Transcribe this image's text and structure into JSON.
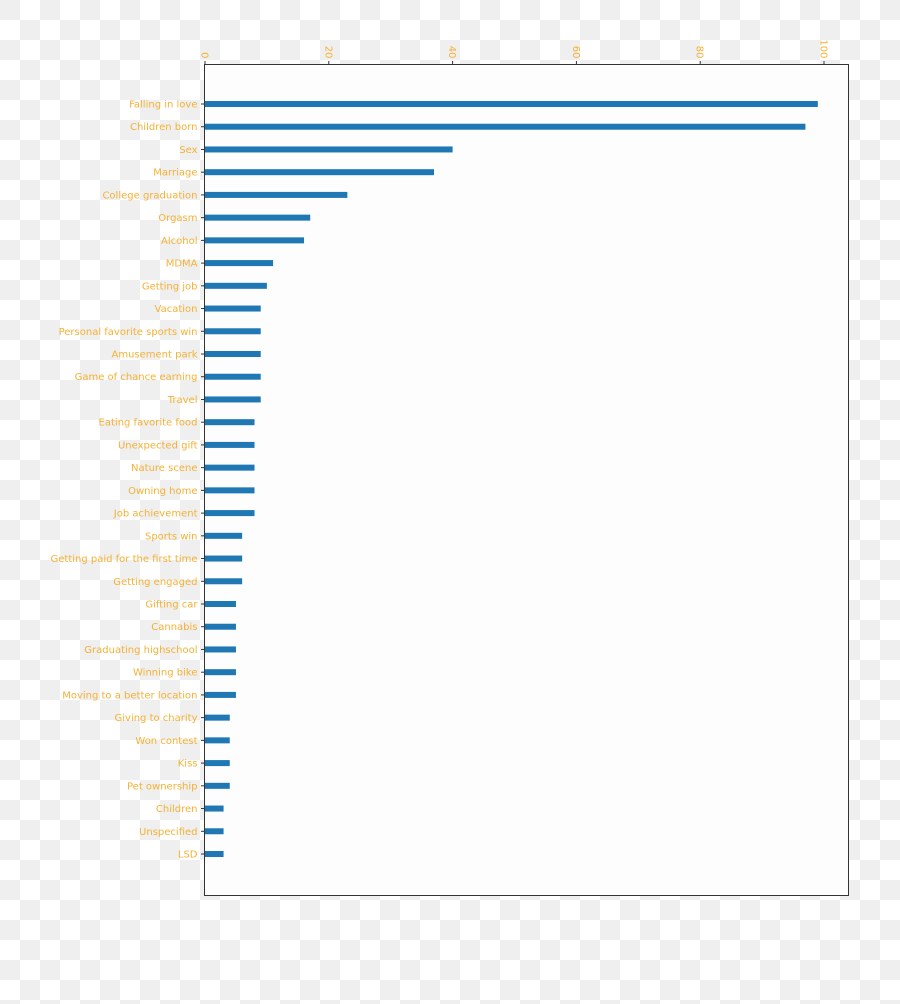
{
  "chart_data": {
    "type": "bar",
    "orientation": "horizontal",
    "title": "",
    "xlabel": "",
    "ylabel": "",
    "xlim": [
      0,
      104
    ],
    "xticks": [
      0,
      20,
      40,
      60,
      80,
      100
    ],
    "xtick_labels": [
      "0",
      "20",
      "40",
      "60",
      "80",
      "100"
    ],
    "x_axis_position": "top",
    "grid": false,
    "legend": null,
    "colors": {
      "bar": "#1f77b4",
      "tick_label": "#f5b134",
      "axes_face": "#fdfdfd",
      "axes_edge": "#333333"
    },
    "categories": [
      "Falling in love",
      "Children born",
      "Sex",
      "Marriage",
      "College graduation",
      "Orgasm",
      "Alcohol",
      "MDMA",
      "Getting job",
      "Vacation",
      "Personal favorite sports win",
      "Amusement park",
      "Game of chance earning",
      "Travel",
      "Eating favorite food",
      "Unexpected gift",
      "Nature scene",
      "Owning home",
      "Job achievement",
      "Sports win",
      "Getting paid for the first time",
      "Getting engaged",
      "Gifting car",
      "Cannabis",
      "Graduating highschool",
      "Winning bike",
      "Moving to a better location",
      "Giving to charity",
      "Won contest",
      "Kiss",
      "Pet ownership",
      "Children",
      "Unspecified",
      "LSD"
    ],
    "values": [
      99,
      97,
      40,
      37,
      23,
      17,
      16,
      11,
      10,
      9,
      9,
      9,
      9,
      9,
      8,
      8,
      8,
      8,
      8,
      6,
      6,
      6,
      5,
      5,
      5,
      5,
      5,
      4,
      4,
      4,
      4,
      3,
      3,
      3
    ]
  }
}
